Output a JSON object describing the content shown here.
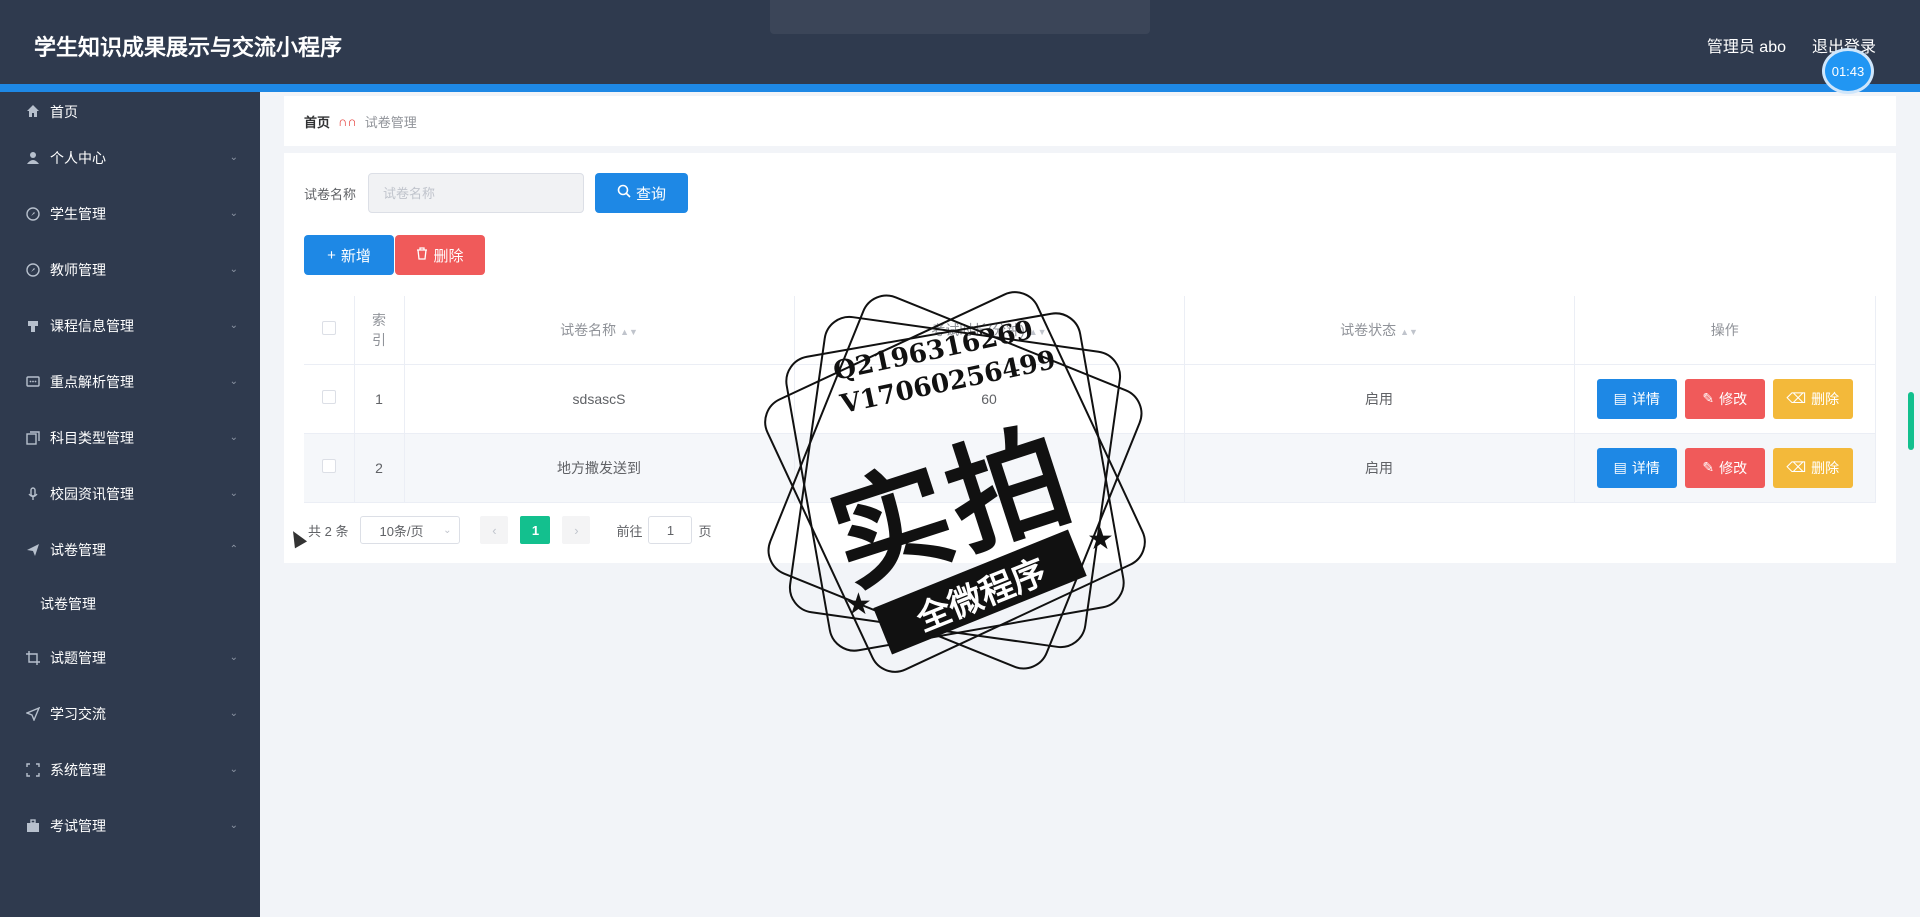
{
  "app": {
    "title": "学生知识成果展示与交流小程序",
    "user_label": "管理员 abo",
    "logout_label": "退出登录",
    "timer": "01:43"
  },
  "sidebar": {
    "items": [
      {
        "label": "首页",
        "icon": "home-icon"
      },
      {
        "label": "个人中心",
        "icon": "user-icon"
      },
      {
        "label": "学生管理",
        "icon": "compass-icon"
      },
      {
        "label": "教师管理",
        "icon": "compass-icon"
      },
      {
        "label": "课程信息管理",
        "icon": "podium-icon"
      },
      {
        "label": "重点解析管理",
        "icon": "chat-icon"
      },
      {
        "label": "科目类型管理",
        "icon": "copy-icon"
      },
      {
        "label": "校园资讯管理",
        "icon": "microphone-icon"
      },
      {
        "label": "试卷管理",
        "icon": "send-icon",
        "expanded": true
      },
      {
        "label": "试题管理",
        "icon": "crop-icon"
      },
      {
        "label": "学习交流",
        "icon": "position-icon"
      },
      {
        "label": "系统管理",
        "icon": "full-screen-icon"
      },
      {
        "label": "考试管理",
        "icon": "suitcase-icon"
      }
    ],
    "sub_item": "试卷管理"
  },
  "breadcrumb": {
    "home": "首页",
    "current": "试卷管理"
  },
  "search": {
    "label": "试卷名称",
    "placeholder": "试卷名称",
    "query_button": "查询"
  },
  "actions": {
    "add": "新增",
    "delete": "删除"
  },
  "table": {
    "headers": [
      "索引",
      "试卷名称",
      "考试时长(分钟)",
      "试卷状态",
      "操作"
    ],
    "rows": [
      {
        "index": "1",
        "name": "sdsascS",
        "duration": "60",
        "status": "启用"
      },
      {
        "index": "2",
        "name": "地方撒发送到",
        "duration": "",
        "status": "启用"
      }
    ],
    "row_buttons": {
      "detail": "详情",
      "edit": "修改",
      "delete": "删除"
    }
  },
  "pagination": {
    "total": "共 2 条",
    "page_size": "10条/页",
    "current_page": "1",
    "goto_label": "前往",
    "goto_value": "1",
    "page_suffix": "页"
  },
  "watermark": {
    "line1": "Q2196316269",
    "line2": "V17060256499",
    "big": "实拍",
    "ribbon": "全微程序"
  },
  "colors": {
    "header_bg": "#2f3a4e",
    "accent_blue": "#1e88e5",
    "danger": "#f05a5a",
    "warning": "#f3b93a",
    "page_active": "#13c08e"
  }
}
